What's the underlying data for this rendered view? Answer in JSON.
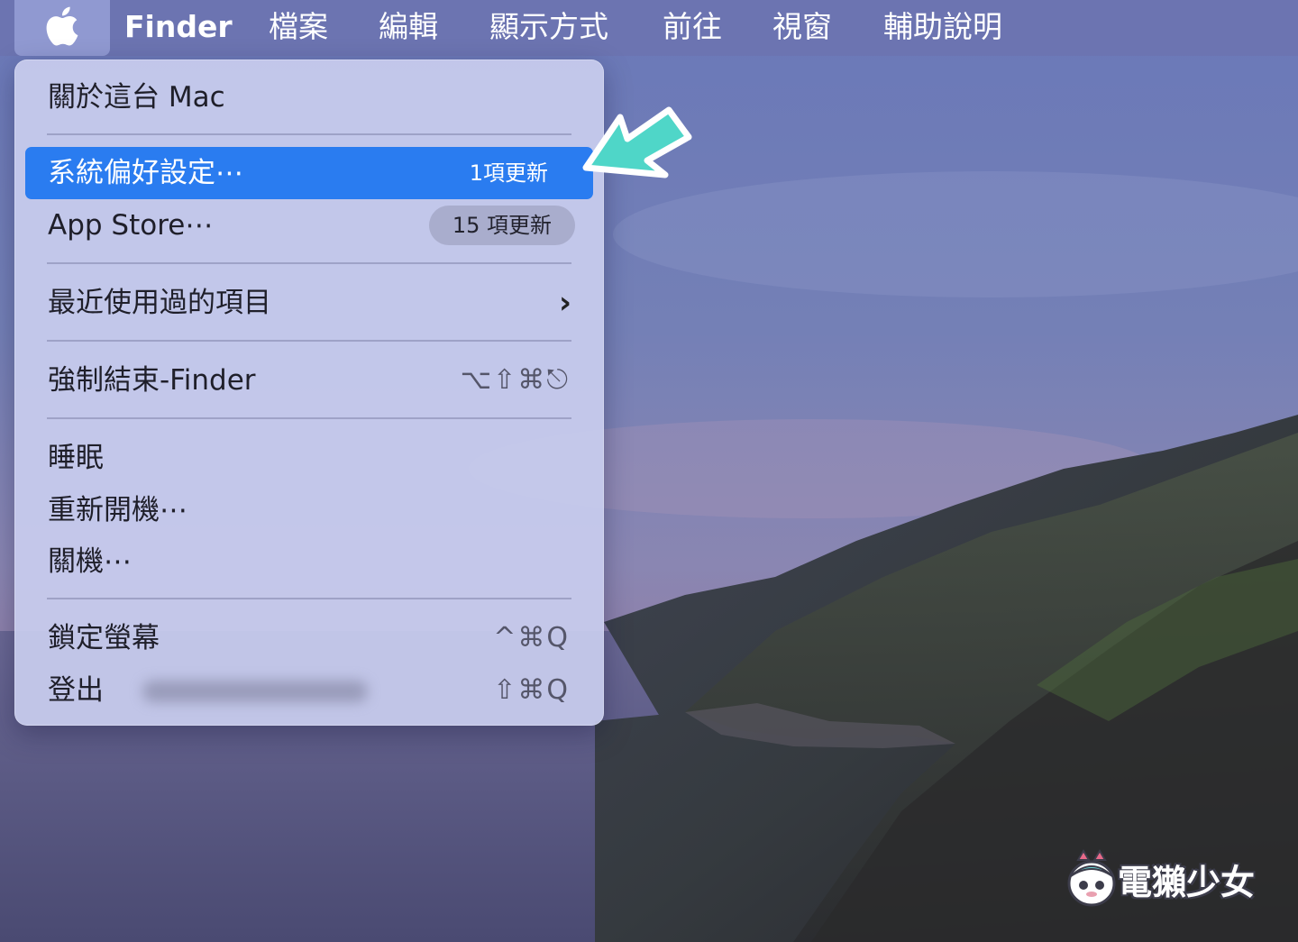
{
  "menubar": {
    "apple_icon": "apple-logo-icon",
    "items": [
      {
        "label": "Finder",
        "active_app": true
      },
      {
        "label": "檔案"
      },
      {
        "label": "編輯"
      },
      {
        "label": "顯示方式"
      },
      {
        "label": "前往"
      },
      {
        "label": "視窗"
      },
      {
        "label": "輔助說明"
      }
    ]
  },
  "apple_menu": {
    "items": [
      {
        "label": "關於這台 Mac"
      },
      {
        "label": "系統偏好設定⋯",
        "badge": "1項更新",
        "highlighted": true
      },
      {
        "label": "App Store⋯",
        "badge": "15 項更新"
      },
      {
        "label": "最近使用過的項目",
        "submenu_icon": "chevron-right-icon"
      },
      {
        "label": "強制結束-Finder",
        "shortcut": "⌥⇧⌘⎋"
      },
      {
        "label": "睡眠"
      },
      {
        "label": "重新開機⋯"
      },
      {
        "label": "關機⋯"
      },
      {
        "label": "鎖定螢幕",
        "shortcut": "^⌘Q"
      },
      {
        "label": "登出",
        "shortcut": "⇧⌘Q",
        "user_name_blurred": true
      }
    ]
  },
  "annotation": {
    "arrow_color": "#4fd6c8",
    "arrow_icon": "pointing-arrow-icon"
  },
  "watermark": {
    "text": "電獺少女",
    "mascot_icon": "otter-mascot-icon"
  },
  "colors": {
    "highlight": "#2a7cf0",
    "menubar": "#6c74b0"
  }
}
